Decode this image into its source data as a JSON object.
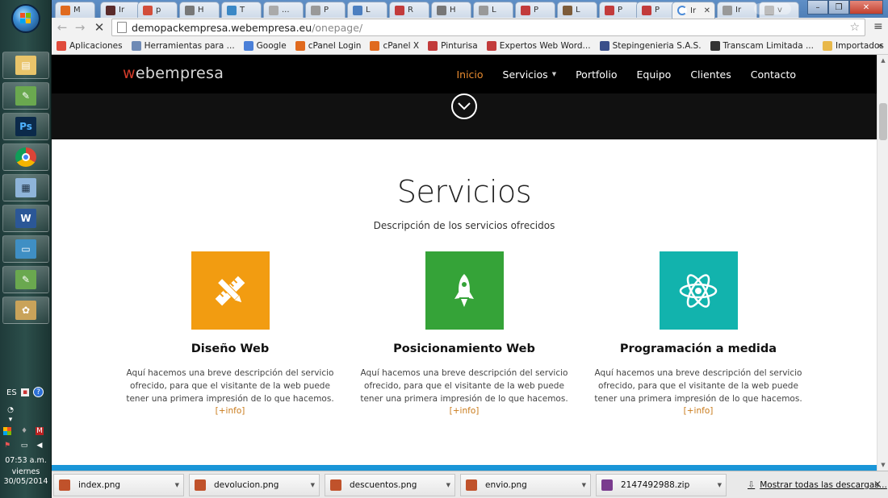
{
  "browser": {
    "tabs": [
      {
        "label": "M",
        "color": "#e06a1e"
      },
      {
        "label": "Ir",
        "color": "#5a2b2b"
      },
      {
        "label": "p",
        "color": "#d24d3a"
      },
      {
        "label": "H",
        "color": "#777777"
      },
      {
        "label": "T",
        "color": "#3b88c6"
      },
      {
        "label": "...",
        "color": "#aaaaaa"
      },
      {
        "label": "P",
        "color": "#999999"
      },
      {
        "label": "L",
        "color": "#4c7fc0"
      },
      {
        "label": "R",
        "color": "#c23b3b"
      },
      {
        "label": "H",
        "color": "#777777"
      },
      {
        "label": "L",
        "color": "#999999"
      },
      {
        "label": "P",
        "color": "#c23b3b"
      },
      {
        "label": "L",
        "color": "#7d5c3a"
      },
      {
        "label": "P",
        "color": "#c23b3b"
      },
      {
        "label": "P",
        "color": "#c23b3b"
      },
      {
        "label": "Ir",
        "color": "#ffffff",
        "active": true
      },
      {
        "label": "Ir",
        "color": "#999999"
      },
      {
        "label": "v",
        "color": "#999999"
      }
    ],
    "url_host": "demopackempresa.webempresa.eu",
    "url_path": "/onepage/",
    "bookmarks": [
      {
        "label": "Aplicaciones",
        "icon": "apps-grid-icon",
        "color": "#e04b3c"
      },
      {
        "label": "Herramientas para ...",
        "icon": "tools-icon",
        "color": "#6f8ab5"
      },
      {
        "label": "Google",
        "icon": "google-icon",
        "color": "#4a7fd8"
      },
      {
        "label": "cPanel Login",
        "icon": "cpanel-icon",
        "color": "#e06a1e"
      },
      {
        "label": "cPanel X",
        "icon": "cpanel-icon",
        "color": "#e06a1e"
      },
      {
        "label": "Pinturisa",
        "icon": "p-icon",
        "color": "#c23b3b"
      },
      {
        "label": "Expertos Web Word...",
        "icon": "webempresa-icon",
        "color": "#c23b3b"
      },
      {
        "label": "Stepingenieria S.A.S.",
        "icon": "s-icon",
        "color": "#3a4f8a"
      },
      {
        "label": "Transcam Limitada ...",
        "icon": "cube-icon",
        "color": "#333333"
      },
      {
        "label": "Importados",
        "icon": "folder-icon",
        "color": "#e8b84a"
      }
    ]
  },
  "site": {
    "logo_prefix": "w",
    "logo_rest": "ebempresa",
    "menu": [
      {
        "label": "Inicio",
        "active": true
      },
      {
        "label": "Servicios",
        "dropdown": true
      },
      {
        "label": "Portfolio"
      },
      {
        "label": "Equipo"
      },
      {
        "label": "Clientes"
      },
      {
        "label": "Contacto"
      }
    ],
    "section_title": "Servicios",
    "section_subtitle": "Descripción de los servicios ofrecidos",
    "services": [
      {
        "title": "Diseño Web",
        "icon": "pencil-ruler-icon",
        "color": "#f29c11",
        "text": "Aquí hacemos una breve descripción del servicio ofrecido, para que el visitante de la web puede tener una primera impresión de lo que hacemos.",
        "more": "[+info]"
      },
      {
        "title": "Posicionamiento Web",
        "icon": "rocket-icon",
        "color": "#35a338",
        "text": "Aquí hacemos una breve descripción del servicio ofrecido, para que el visitante de la web puede tener una primera impresión de lo que hacemos.",
        "more": "[+info]"
      },
      {
        "title": "Programación a medida",
        "icon": "atom-icon",
        "color": "#12b3ad",
        "text": "Aquí hacemos una breve descripción del servicio ofrecido, para que el visitante de la web puede tener una primera impresión de lo que hacemos.",
        "more": "[+info]"
      }
    ]
  },
  "downloads": {
    "items": [
      "index.png",
      "devolucion.png",
      "descuentos.png",
      "envio.png",
      "2147492988.zip"
    ],
    "show_all": "Mostrar todas las descargas..."
  },
  "system": {
    "language": "ES",
    "time": "07:53 a.m.",
    "day": "viernes",
    "date": "30/05/2014"
  }
}
